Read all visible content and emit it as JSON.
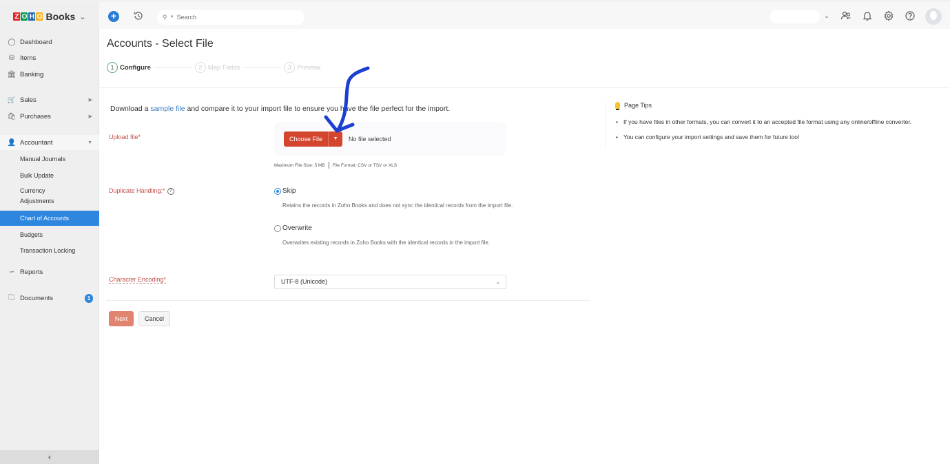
{
  "topbar": {
    "brand_logo_letters": [
      "Z",
      "O",
      "H",
      "O"
    ],
    "brand_logo_colors": [
      "#e42527",
      "#089949",
      "#226db4",
      "#f9b21d"
    ],
    "brand_name": "Books",
    "search_placeholder": "Search"
  },
  "sidebar": {
    "items": [
      {
        "label": "Dashboard",
        "icon": "dashboard-icon"
      },
      {
        "label": "Items",
        "icon": "basket-icon"
      },
      {
        "label": "Banking",
        "icon": "bank-icon"
      },
      {
        "label": "Sales",
        "icon": "cart-icon"
      },
      {
        "label": "Purchases",
        "icon": "bag-icon"
      },
      {
        "label": "Accountant",
        "icon": "accountant-icon"
      },
      {
        "label": "Manual Journals"
      },
      {
        "label": "Bulk Update"
      },
      {
        "label": "Currency\nAdjustments"
      },
      {
        "label": "Chart of Accounts"
      },
      {
        "label": "Budgets"
      },
      {
        "label": "Transaction Locking"
      },
      {
        "label": "Reports",
        "icon": "reports-icon"
      },
      {
        "label": "Documents",
        "icon": "folder-icon",
        "badge": "1"
      }
    ],
    "currency_line1": "Currency",
    "currency_line2": "Adjustments"
  },
  "page": {
    "title": "Accounts - Select File",
    "steps": [
      {
        "num": "1",
        "label": "Configure",
        "active": true
      },
      {
        "num": "2",
        "label": "Map Fields",
        "active": false
      },
      {
        "num": "3",
        "label": "Preview",
        "active": false
      }
    ]
  },
  "form": {
    "intro_before": "Download a ",
    "intro_link": "sample file",
    "intro_after": " and compare it to your import file to ensure you have the file perfect for the import.",
    "upload_label": "Upload file*",
    "choose_file_label": "Choose File",
    "no_file_text": "No file selected",
    "max_size_text": "Maximum File Size: 5 MB",
    "format_text": "File Format: CSV or TSV or XLS",
    "duplicate_label": "Duplicate Handling:*",
    "options": [
      {
        "label": "Skip",
        "checked": true,
        "desc": "Retains the records in Zoho Books and does not sync the identical records from the import file."
      },
      {
        "label": "Overwrite",
        "checked": false,
        "desc": "Overwrites existing records in Zoho Books with the identical records in the import file."
      }
    ],
    "encoding_label": "Character Encoding*",
    "encoding_value": "UTF-8 (Unicode)",
    "next_label": "Next",
    "cancel_label": "Cancel"
  },
  "tips": {
    "title": "Page Tips",
    "items": [
      "If you have files in other formats, you can convert it to an accepted file format using any online/offline converter.",
      "You can configure your import settings and save them for future too!"
    ]
  },
  "colors": {
    "accent": "#2e86de",
    "primary_button": "#d4452e",
    "label_required": "#c0504d",
    "annotation": "#1a3fd1"
  }
}
